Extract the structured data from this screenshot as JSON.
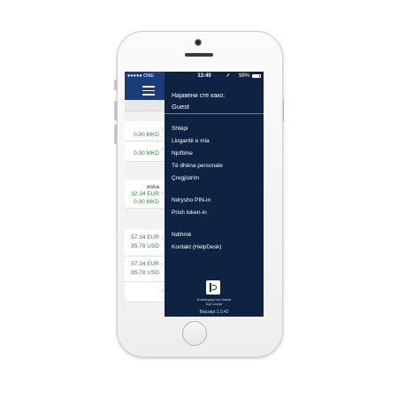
{
  "status_bar": {
    "carrier": "●●●●● ONE",
    "time": "13:40",
    "battery": "98%"
  },
  "background_app": {
    "accounts": [
      {
        "amount": "0.00 MKD"
      },
      {
        "amount": "0.00 MKD"
      },
      {
        "name": "eska",
        "amount_1": "32.34 EUR",
        "amount_2": "0.00 MKD"
      },
      {
        "amount_1": "57.34 EUR",
        "amount_2": "85.78 USD"
      },
      {
        "amount_1": "57.34 EUR",
        "amount_2": "85.78 USD"
      },
      {}
    ]
  },
  "drawer": {
    "logged_in_label": "Најавени сте како:",
    "user": "Guest",
    "menu": [
      {
        "label": "Shtëpi"
      },
      {
        "label": "Llogaritë e mia"
      },
      {
        "label": "Njoftime"
      },
      {
        "label": "Të dhëna personale"
      },
      {
        "label": "Çregjistrim"
      },
      {
        "label": "Ndrysho PIN-in"
      },
      {
        "label": "Prish token-in"
      },
      {
        "label": "Ndihmë"
      },
      {
        "label": "Kontakt (HelpDesk)"
      }
    ],
    "bank_name_line1": "Комерцијална банка",
    "bank_name_line2": "АД Скопје",
    "version": "Верзија 1.0.42"
  },
  "colors": {
    "drawer_bg": "#0d2341",
    "header_bg": "#1a3c7a",
    "amount_green": "#2e8b3a"
  },
  "icons": {
    "menu": "hamburger-icon",
    "chevron": "chevron-right-icon",
    "location": "location-arrow-icon",
    "wifi": "wifi-icon",
    "battery": "battery-icon",
    "logo": "bank-logo-icon"
  }
}
